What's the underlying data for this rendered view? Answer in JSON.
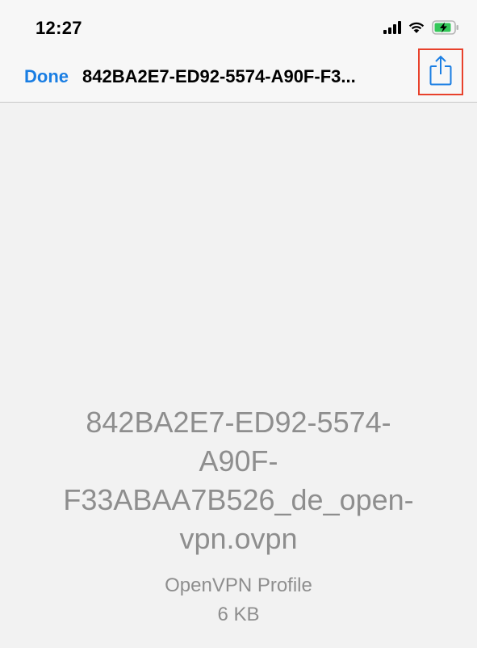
{
  "status": {
    "time": "12:27"
  },
  "nav": {
    "done_label": "Done",
    "title": "842BA2E7-ED92-5574-A90F-F3..."
  },
  "document": {
    "name_lines": [
      "842BA2E7-ED92-5574-",
      "A90F-",
      "F33ABAA7B526_de_open-",
      "vpn.ovpn"
    ],
    "type": "OpenVPN Profile",
    "size": "6 KB"
  },
  "colors": {
    "accent": "#1a7ee3",
    "highlight_border": "#e8412b",
    "battery": "#34c759"
  },
  "icons": {
    "signal": "cellular-signal-icon",
    "wifi": "wifi-icon",
    "battery": "battery-charging-icon",
    "share": "share-icon"
  }
}
